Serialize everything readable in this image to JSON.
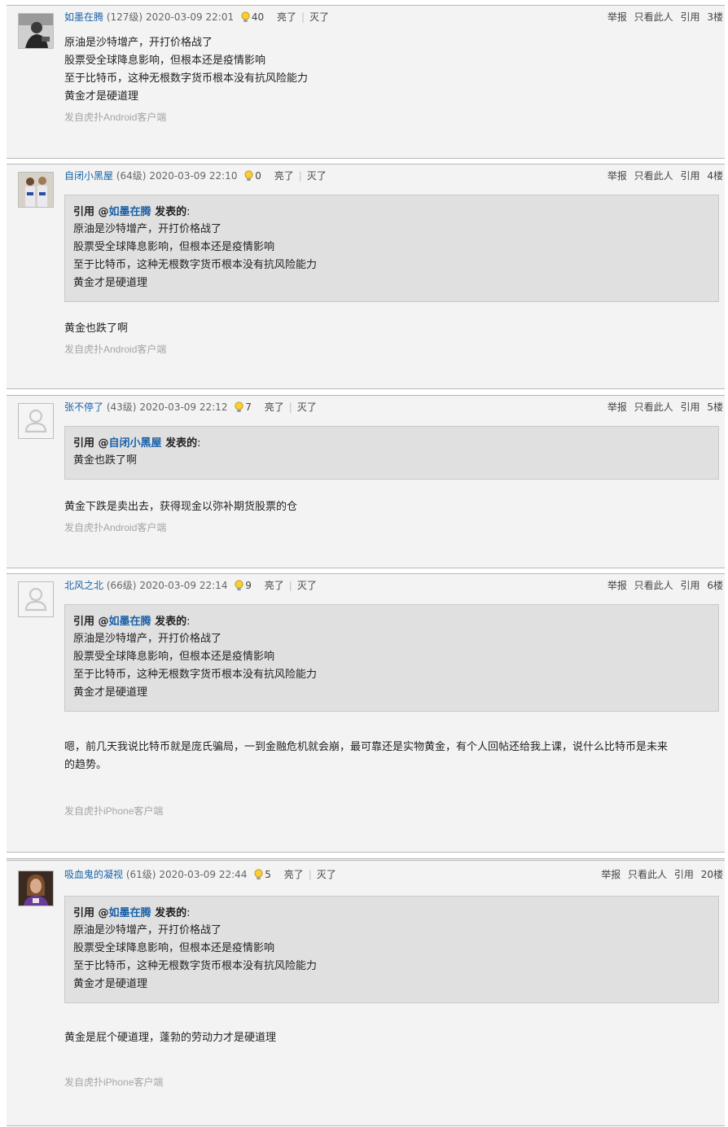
{
  "ui": {
    "quote_prefix": "引用 @",
    "quote_suffix": " 发表的",
    "quote_colon": ":",
    "liang": "亮了",
    "mie": "灭了",
    "report": "举报",
    "only_this": "只看此人",
    "quote_action": "引用"
  },
  "posts": [
    {
      "username": "如墨在腾",
      "level": "(127级)",
      "time": "2020-03-09 22:01",
      "lights": "40",
      "floor": "3楼",
      "lines": [
        "原油是沙特增产，开打价格战了",
        "股票受全球降息影响，但根本还是疫情影响",
        "至于比特币，这种无根数字货币根本没有抗风险能力",
        "黄金才是硬道理"
      ],
      "source": "发自虎扑Android客户端"
    },
    {
      "username": "自闭小黑屋",
      "level": "(64级)",
      "time": "2020-03-09 22:10",
      "lights": "0",
      "floor": "4楼",
      "quote_user": "如墨在腾",
      "quote_lines": [
        "原油是沙特增产，开打价格战了",
        "股票受全球降息影响，但根本还是疫情影响",
        "至于比特币，这种无根数字货币根本没有抗风险能力",
        "黄金才是硬道理"
      ],
      "lines": [
        "黄金也跌了啊"
      ],
      "source": "发自虎扑Android客户端"
    },
    {
      "username": "张不停了",
      "level": "(43级)",
      "time": "2020-03-09 22:12",
      "lights": "7",
      "floor": "5楼",
      "quote_user": "自闭小黑屋",
      "quote_lines": [
        "黄金也跌了啊"
      ],
      "lines": [
        "黄金下跌是卖出去，获得现金以弥补期货股票的仓"
      ],
      "source": "发自虎扑Android客户端"
    },
    {
      "username": "北风之北",
      "level": "(66级)",
      "time": "2020-03-09 22:14",
      "lights": "9",
      "floor": "6楼",
      "quote_user": "如墨在腾",
      "quote_lines": [
        "原油是沙特增产，开打价格战了",
        "股票受全球降息影响，但根本还是疫情影响",
        "至于比特币，这种无根数字货币根本没有抗风险能力",
        "黄金才是硬道理"
      ],
      "lines": [
        "嗯，前几天我说比特币就是庞氏骗局，一到金融危机就会崩，最可靠还是实物黄金，有个人回帖还给我上课，说什么比特币是未来",
        "的趋势。"
      ],
      "source": "发自虎扑iPhone客户端"
    },
    {
      "username": "吸血鬼的凝视",
      "level": "(61级)",
      "time": "2020-03-09 22:44",
      "lights": "5",
      "floor": "20楼",
      "quote_user": "如墨在腾",
      "quote_lines": [
        "原油是沙特增产，开打价格战了",
        "股票受全球降息影响，但根本还是疫情影响",
        "至于比特币，这种无根数字货币根本没有抗风险能力",
        "黄金才是硬道理"
      ],
      "lines": [
        "黄金是屁个硬道理，蓬勃的劳动力才是硬道理"
      ],
      "source": "发自虎扑iPhone客户端"
    }
  ]
}
